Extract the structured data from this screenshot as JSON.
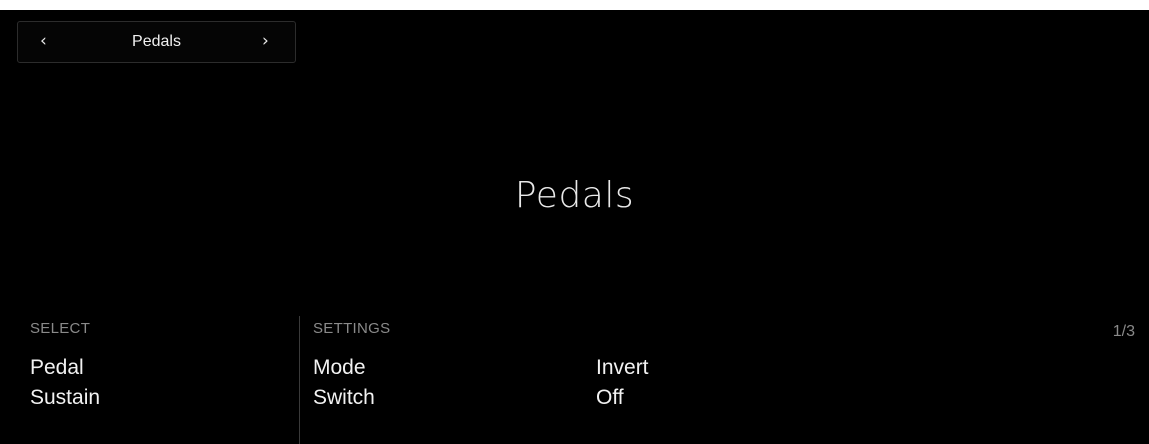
{
  "nav": {
    "prev_icon": "chevron-left-icon",
    "prev_glyph": "‹",
    "title": "Pedals",
    "next_icon": "chevron-right-icon",
    "next_glyph": "›"
  },
  "main": {
    "title": "Pedals"
  },
  "select": {
    "label": "SELECT",
    "param": "Pedal",
    "value": "Sustain"
  },
  "settings": {
    "label": "SETTINGS",
    "params": [
      {
        "name": "Mode",
        "value": "Switch"
      },
      {
        "name": "Invert",
        "value": "Off"
      }
    ]
  },
  "page_indicator": "1/3",
  "colors": {
    "background": "#000000",
    "text": "#ffffff",
    "muted": "#8a8a8a"
  }
}
